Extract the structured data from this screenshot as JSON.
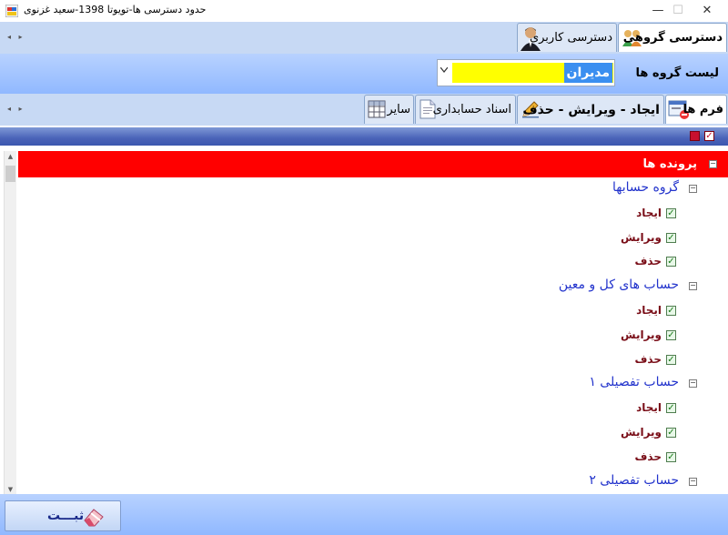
{
  "window": {
    "title": "حدود دسترسی ها-تویوتا 1398-سعید غزنوی",
    "minimize": "—",
    "maximize": "☐",
    "close": "✕"
  },
  "top_tabs": {
    "scroll_arrows": "◂ ▸",
    "items": [
      {
        "label": "دسترسی گروهی",
        "icon": "group-users-icon",
        "active": true
      },
      {
        "label": "دسترسی کاربری",
        "icon": "user-icon",
        "active": false
      }
    ]
  },
  "group": {
    "label": "لیست گروه ها",
    "selected": "مدیران",
    "highlight_color": "#ffff00"
  },
  "sub_tabs": {
    "scroll_arrows": "◂ ▸",
    "items": [
      {
        "label": "فرم ها",
        "icon": "form-icon",
        "active": true
      },
      {
        "label": "ایجاد - ویرایش - حذف",
        "icon": "pencil-icon",
        "active": false
      },
      {
        "label": "اسناد حسابداری",
        "icon": "document-icon",
        "active": false
      },
      {
        "label": "سایر",
        "icon": "grid-icon",
        "active": false
      }
    ]
  },
  "tree": {
    "root": {
      "label": "پرونده ها",
      "color": "#ff0000"
    },
    "groups": [
      {
        "label": "گروه حسابها",
        "perms": [
          "ایجاد",
          "ویرایش",
          "حذف"
        ]
      },
      {
        "label": "حساب های کل و معین",
        "perms": [
          "ایجاد",
          "ویرایش",
          "حذف"
        ]
      },
      {
        "label": "حساب تفصیلی ۱",
        "perms": [
          "ایجاد",
          "ویرایش",
          "حذف"
        ]
      },
      {
        "label": "حساب تفصیلی ۲",
        "perms": []
      }
    ]
  },
  "footer": {
    "save_label": "ثبـــت"
  }
}
